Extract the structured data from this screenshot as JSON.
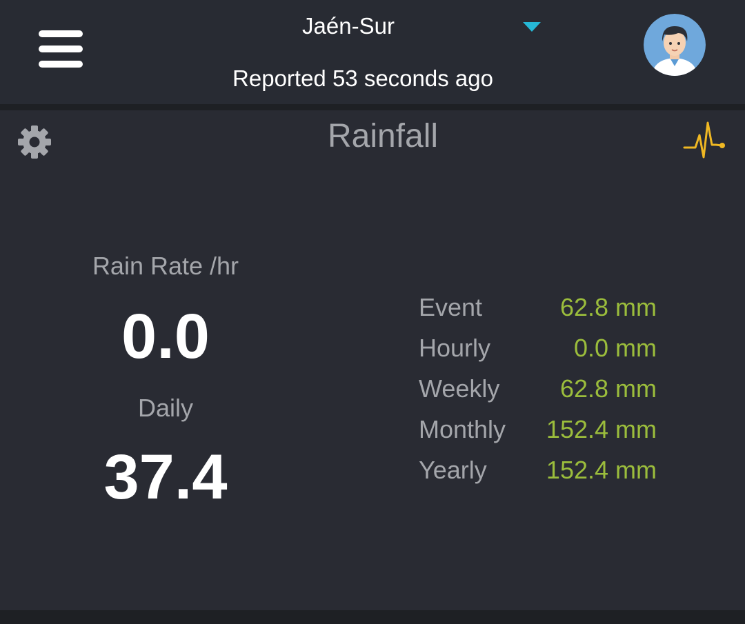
{
  "header": {
    "station_name": "Jaén-Sur",
    "reported_text": "Reported 53 seconds ago",
    "menu_icon": "hamburger-icon",
    "dropdown_icon": "caret-down-icon",
    "avatar_icon": "user-avatar"
  },
  "panel": {
    "title": "Rainfall",
    "settings_icon": "gear-icon",
    "chart_icon": "pulse-icon",
    "rain_rate_label": "Rain Rate /hr",
    "rain_rate_value": "0.0",
    "daily_label": "Daily",
    "daily_value": "37.4",
    "stats": [
      {
        "label": "Event",
        "value": "62.8 mm"
      },
      {
        "label": "Hourly",
        "value": "0.0 mm"
      },
      {
        "label": "Weekly",
        "value": "62.8 mm"
      },
      {
        "label": "Monthly",
        "value": "152.4 mm"
      },
      {
        "label": "Yearly",
        "value": "152.4 mm"
      }
    ]
  },
  "colors": {
    "background": "#1e2024",
    "panel": "#292b33",
    "accent_caret": "#26b8d6",
    "value_green": "#9bbd3c",
    "pulse_yellow": "#f0b823",
    "label_gray": "#a4a6ab"
  }
}
